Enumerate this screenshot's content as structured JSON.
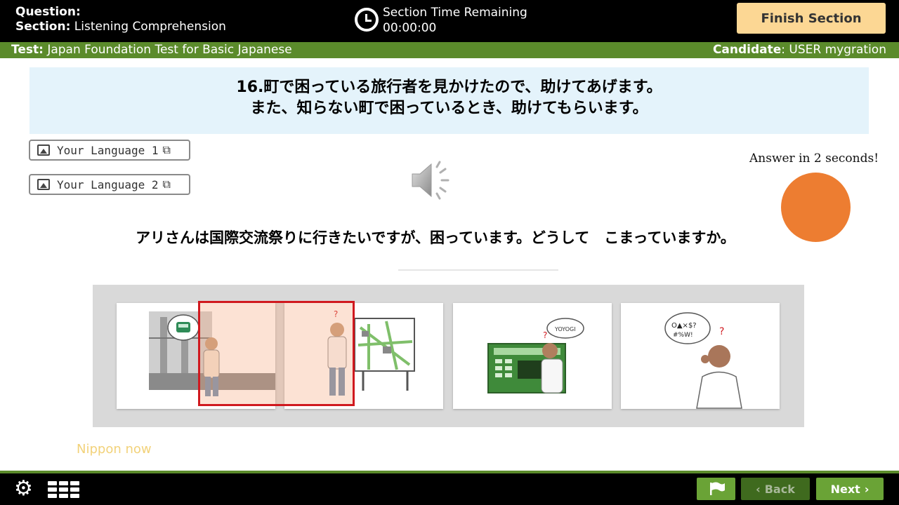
{
  "header": {
    "question_label": "Question:",
    "section_label": "Section:",
    "section_value": "Listening Comprehension",
    "timer_title": "Section Time Remaining",
    "timer_value": "00:00:00",
    "finish_label": "Finish Section"
  },
  "testbar": {
    "test_label": "Test:",
    "test_value": "Japan Foundation Test for Basic Japanese",
    "candidate_label": "Candidate",
    "candidate_value": ": USER mygration"
  },
  "question": {
    "line1": "16.町で困っている旅行者を見かけたので、助けてあげます。",
    "line2": "また、知らない町で困っているとき、助けてもらいます。"
  },
  "language_buttons": [
    {
      "label": "Your Language 1"
    },
    {
      "label": "Your Language 2"
    }
  ],
  "answer_note": "Answer in 2 seconds!",
  "sub_question": "アリさんは国際交流祭りに行きたいですが、困っています。どうして　こまっていますか。",
  "choices": [
    {
      "id": 1,
      "selected": true
    },
    {
      "id": 2,
      "selected": true
    },
    {
      "id": 3,
      "selected": false,
      "sign_text": "YOYOGI"
    },
    {
      "id": 4,
      "selected": false,
      "bubble_line1": "O▲×$?",
      "bubble_line2": "#%W!"
    }
  ],
  "brand": "Nippon now",
  "footer": {
    "back_label": "Back",
    "next_label": "Next"
  },
  "colors": {
    "header_bg": "#000000",
    "green_bar": "#5b8b2b",
    "finish_button": "#fcd794",
    "question_bg": "#e4f3fb",
    "selection_border": "#d0191f",
    "orange_dot": "#ed7d31",
    "next_button": "#6aa336"
  }
}
